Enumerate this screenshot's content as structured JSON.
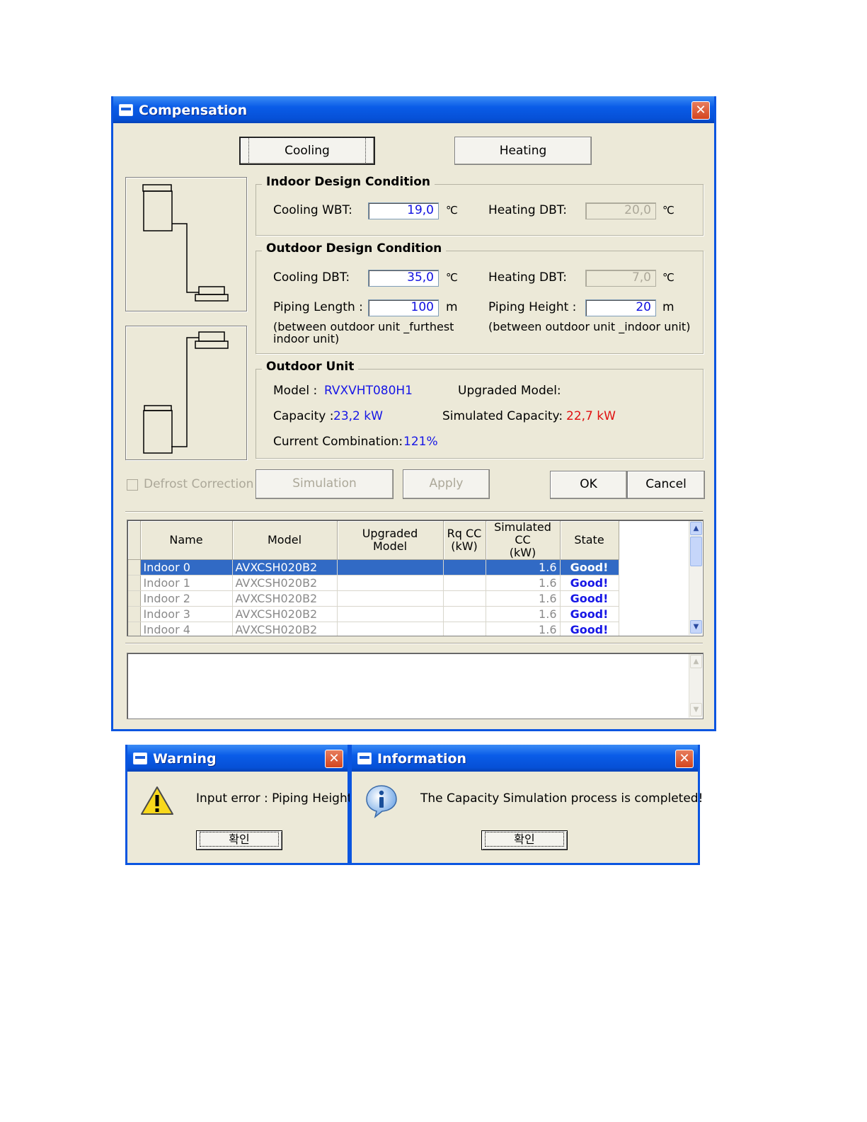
{
  "compensation": {
    "title": "Compensation",
    "close_glyph": "✕",
    "mode_buttons": {
      "cooling": "Cooling",
      "heating": "Heating"
    },
    "indoor_design": {
      "title": "Indoor Design Condition",
      "cooling_wbt_label": "Cooling WBT:",
      "cooling_wbt_value": "19,0",
      "cooling_wbt_unit": "℃",
      "heating_dbt_label": "Heating DBT:",
      "heating_dbt_value": "20,0",
      "heating_dbt_unit": "℃"
    },
    "outdoor_design": {
      "title": "Outdoor Design Condition",
      "cooling_dbt_label": "Cooling DBT:",
      "cooling_dbt_value": "35,0",
      "cooling_dbt_unit": "℃",
      "heating_dbt_label": "Heating DBT:",
      "heating_dbt_value": "7,0",
      "heating_dbt_unit": "℃",
      "piping_length_label": "Piping Length :",
      "piping_length_value": "100",
      "piping_length_unit": "m",
      "piping_length_note_1": "(between outdoor unit _furthest",
      "piping_length_note_2": "indoor unit)",
      "piping_height_label": "Piping Height :",
      "piping_height_value": "20",
      "piping_height_unit": "m",
      "piping_height_note": "(between outdoor unit _indoor unit)"
    },
    "outdoor_unit": {
      "title": "Outdoor Unit",
      "model_label": "Model :",
      "model_value": "RVXVHT080H1",
      "upgraded_model_label": "Upgraded Model:",
      "capacity_label": "Capacity :",
      "capacity_value": "23,2 kW",
      "simulated_capacity_label": "Simulated Capacity:",
      "simulated_capacity_value": "22,7 kW",
      "current_combination_label": "Current Combination:",
      "current_combination_value": "121%"
    },
    "defrost_label": "Defrost Correction",
    "buttons": {
      "simulation": "Simulation",
      "apply": "Apply",
      "ok": "OK",
      "cancel": "Cancel"
    },
    "grid": {
      "headers": {
        "name": "Name",
        "model": "Model",
        "upgraded_1": "Upgraded",
        "upgraded_2": "Model",
        "rqcc_1": "Rq CC",
        "rqcc_2": "(kW)",
        "simcc_1": "Simulated CC",
        "simcc_2": "(kW)",
        "state": "State"
      },
      "rows": [
        {
          "name": "Indoor  0",
          "model": "AVXCSH020B2",
          "upgraded": "",
          "rqcc": "",
          "simcc": "1.6",
          "state": "Good!"
        },
        {
          "name": "Indoor  1",
          "model": "AVXCSH020B2",
          "upgraded": "",
          "rqcc": "",
          "simcc": "1.6",
          "state": "Good!"
        },
        {
          "name": "Indoor  2",
          "model": "AVXCSH020B2",
          "upgraded": "",
          "rqcc": "",
          "simcc": "1.6",
          "state": "Good!"
        },
        {
          "name": "Indoor  3",
          "model": "AVXCSH020B2",
          "upgraded": "",
          "rqcc": "",
          "simcc": "1.6",
          "state": "Good!"
        },
        {
          "name": "Indoor  4",
          "model": "AVXCSH020B2",
          "upgraded": "",
          "rqcc": "",
          "simcc": "1.6",
          "state": "Good!"
        }
      ],
      "selected_row": 0
    }
  },
  "warning": {
    "title": "Warning",
    "close_glyph": "✕",
    "message": "Input error : Piping Height",
    "button": "확인"
  },
  "information": {
    "title": "Information",
    "close_glyph": "✕",
    "message": "The Capacity Simulation process is completed!",
    "button": "확인"
  },
  "colors": {
    "titlebar": "#0a5ce8",
    "dialog_face": "#ece9d8",
    "value_blue": "#1616e6",
    "value_red": "#e01010",
    "selection": "#316ac5"
  }
}
